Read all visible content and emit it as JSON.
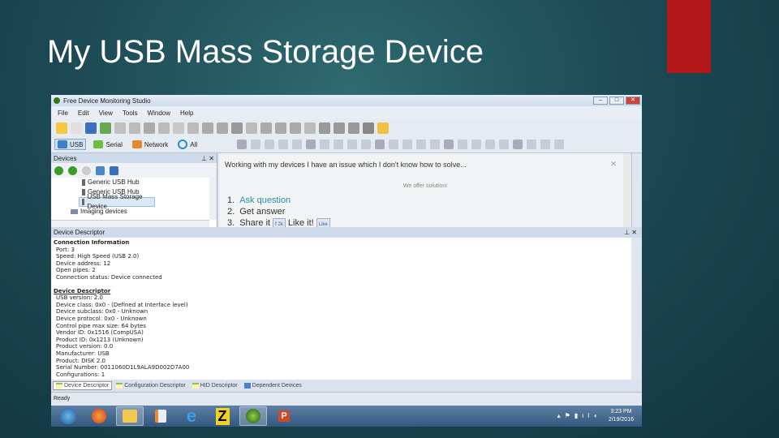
{
  "slide": {
    "title": "My USB Mass Storage Device",
    "accent": "#b3191a"
  },
  "window": {
    "title": "Free Device Monitoring Studio",
    "controls": [
      "–",
      "□",
      "✕"
    ]
  },
  "menu": [
    "File",
    "Edit",
    "View",
    "Tools",
    "Window",
    "Help"
  ],
  "device_tabs": [
    "USB",
    "Serial",
    "Network",
    "All"
  ],
  "devices_pane": {
    "title": "Devices",
    "pin": "⊥",
    "close": "✕",
    "tree": [
      "Generic USB Hub",
      "Generic USB Hub",
      "USB Mass Storage Device",
      "Imaging devices"
    ]
  },
  "web": {
    "question": "Working with my devices I have an issue which I don't know how to solve...",
    "close": "✕",
    "offer": "We offer solution!",
    "steps": [
      {
        "n": "1.",
        "text": "Ask question"
      },
      {
        "n": "2.",
        "text": "Get answer"
      },
      {
        "n": "3.",
        "text": "Share it",
        "extra": "Like it!"
      }
    ],
    "share_badge": "f 2k",
    "like_badge": "Like"
  },
  "descriptor": {
    "title": "Device Descriptor",
    "pin": "⊥",
    "close": "✕",
    "connection_header": "Connection Information",
    "connection": [
      "Port: 3",
      "Speed: High Speed (USB 2.0)",
      "Device address: 12",
      "Open pipes: 2",
      "Connection status: Device connected"
    ],
    "device_header": "Device Descriptor",
    "device": [
      "USB version: 2.0",
      "Device class: 0x0 - (Defined at Interface level)",
      "Device subclass: 0x0 - Unknown",
      "Device protocol: 0x0 - Unknown",
      "Control pipe max size: 64 bytes",
      "Vendor ID: 0x1516 (CompUSA)",
      "Product ID: 0x1213 (Unknown)",
      "Product version: 0.0",
      "Manufacturer: USB",
      "Product: DISK 2.0",
      "Serial Number: 0011060D1L9ALA9D002D7A00",
      "Configurations: 1"
    ]
  },
  "bottom_tabs": [
    "Device Descriptor",
    "Configuration Descriptor",
    "HID Descriptor",
    "Dependent Devices"
  ],
  "status": "Ready",
  "taskbar": {
    "time": "3:23 PM",
    "date": "2/19/2016"
  }
}
